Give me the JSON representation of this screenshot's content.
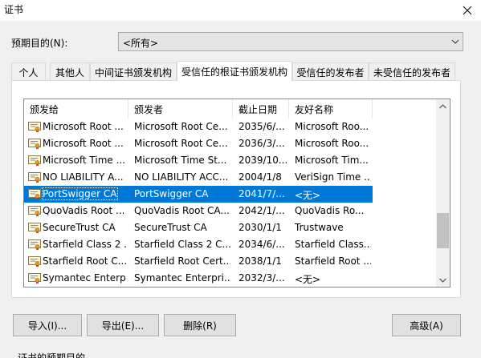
{
  "window": {
    "title": "证书"
  },
  "purpose": {
    "label": "预期目的(N):",
    "selected": "<所有>"
  },
  "tabs": [
    {
      "label": "个人"
    },
    {
      "label": "其他人"
    },
    {
      "label": "中间证书颁发机构"
    },
    {
      "label": "受信任的根证书颁发机构",
      "active": true
    },
    {
      "label": "受信任的发布者"
    },
    {
      "label": "未受信任的发布者"
    }
  ],
  "columns": [
    "颁发给",
    "颁发者",
    "截止日期",
    "友好名称"
  ],
  "rows": [
    {
      "issued_to": "Microsoft Root ...",
      "issued_by": "Microsoft Root Ce...",
      "expires": "2035/6/...",
      "friendly": "Microsoft Roo..."
    },
    {
      "issued_to": "Microsoft Root ...",
      "issued_by": "Microsoft Root Ce...",
      "expires": "2036/3/...",
      "friendly": "Microsoft Roo..."
    },
    {
      "issued_to": "Microsoft Time ...",
      "issued_by": "Microsoft Time St...",
      "expires": "2039/10...",
      "friendly": "Microsoft Tim..."
    },
    {
      "issued_to": "NO LIABILITY A...",
      "issued_by": "NO LIABILITY ACC...",
      "expires": "2004/1/8",
      "friendly": "VeriSign Time ..."
    },
    {
      "issued_to": "PortSwigger CA",
      "issued_by": "PortSwigger CA",
      "expires": "2041/7/...",
      "friendly": "<无>",
      "selected": true
    },
    {
      "issued_to": "QuoVadis Root ...",
      "issued_by": "QuoVadis Root CA...",
      "expires": "2042/1/...",
      "friendly": "QuoVadis Ro..."
    },
    {
      "issued_to": "SecureTrust CA",
      "issued_by": "SecureTrust CA",
      "expires": "2030/1/1",
      "friendly": "Trustwave"
    },
    {
      "issued_to": "Starfield Class 2 ...",
      "issued_by": "Starfield Class 2 C...",
      "expires": "2034/6/...",
      "friendly": "Starfield Class..."
    },
    {
      "issued_to": "Starfield Root C...",
      "issued_by": "Starfield Root Cert...",
      "expires": "2038/1/1",
      "friendly": "Starfield Root ..."
    },
    {
      "issued_to": "Symantec Enterp...",
      "issued_by": "Symantec Enterpri...",
      "expires": "2032/3/...",
      "friendly": "<无>"
    }
  ],
  "buttons": {
    "import": "导入(I)...",
    "export": "导出(E)...",
    "remove": "删除(R)",
    "advanced": "高级(A)"
  },
  "footer": {
    "label": "证书的预期目的"
  },
  "colors": {
    "selection": "#0078d7",
    "dialog_bg": "#f0f0f0"
  }
}
